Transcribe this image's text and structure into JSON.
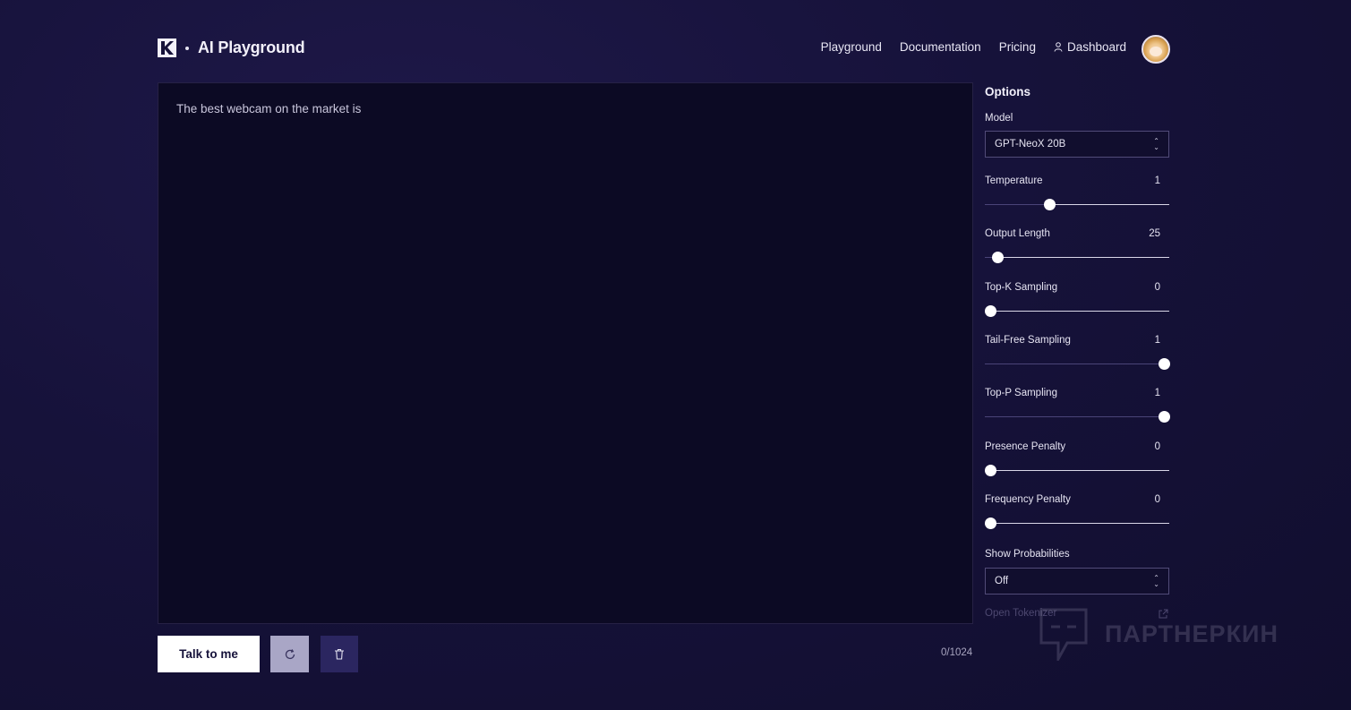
{
  "header": {
    "brand_separator": "•",
    "brand": "AI Playground",
    "nav": {
      "playground": "Playground",
      "documentation": "Documentation",
      "pricing": "Pricing",
      "dashboard": "Dashboard"
    }
  },
  "editor": {
    "prompt": "The best webcam on the market is",
    "counter": "0/1024"
  },
  "actions": {
    "talk": "Talk to me",
    "retry_icon": "refresh-icon",
    "delete_icon": "trash-icon"
  },
  "options": {
    "title": "Options",
    "model": {
      "label": "Model",
      "value": "GPT-NeoX 20B"
    },
    "sliders": [
      {
        "label": "Temperature",
        "value": "1",
        "level": 0.35
      },
      {
        "label": "Output Length",
        "value": "25",
        "level": 0.07
      },
      {
        "label": "Top-K Sampling",
        "value": "0",
        "level": 0.03
      },
      {
        "label": "Tail-Free Sampling",
        "value": "1",
        "level": 0.97
      },
      {
        "label": "Top-P Sampling",
        "value": "1",
        "level": 0.97
      },
      {
        "label": "Presence Penalty",
        "value": "0",
        "level": 0.03
      },
      {
        "label": "Frequency Penalty",
        "value": "0",
        "level": 0.03
      }
    ],
    "show_probabilities": {
      "label": "Show Probabilities",
      "value": "Off"
    },
    "tokenizer": "Open Tokenizer"
  },
  "watermark": "ПАРТНЕРКИН",
  "colors": {
    "background": "#16123a",
    "editor": "#0c0a24",
    "accent_button": "#2b2660",
    "retry_button": "#a9a6c6"
  }
}
